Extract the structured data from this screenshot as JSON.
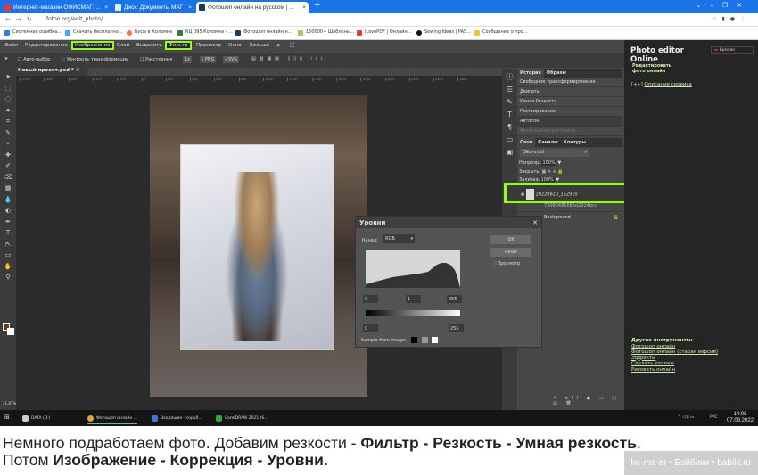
{
  "browser": {
    "tabs": [
      {
        "label": "Интернет-магазин ОФИСМАГ: ...",
        "color": "#e53935"
      },
      {
        "label": "Диск: Документы МАГ",
        "color": "#ffffff"
      },
      {
        "label": "Фотошоп онлайн на русском | ...",
        "color": "#1e3a5f",
        "active": true
      }
    ],
    "url": "fotoo.org/edit_photo/",
    "bookmarks": [
      "Системная ошибка...",
      "Скачать бесплатно...",
      "Бусы в Коломне",
      "КЦ 095 Коломна - ...",
      "Фотошоп онлайн н...",
      "150000+ Шаблоны...",
      "iLovePDF | Онлайн...",
      "Sewing Ideas | PAS...",
      "Сообщение о про..."
    ]
  },
  "editor": {
    "menu": [
      "Файл",
      "Редактирование",
      "Изображение",
      "Слой",
      "Выделить",
      "Фильтр",
      "Просмотр",
      "Окно",
      "Больше"
    ],
    "highlighted_menu": [
      "Изображение",
      "Фильтр"
    ],
    "options": {
      "auto_select": "Авто-выбор",
      "transform": "Контроль трансформации",
      "distances": "Расстояния",
      "scale": "1x",
      "png": "PNG",
      "svg": "SVG"
    },
    "doc_tab": "Новый проект.psd *",
    "ruler_ticks": [
      "-1000",
      "-800",
      "-600",
      "-400",
      "-200",
      "0",
      "200",
      "400",
      "600",
      "800",
      "1000",
      "1200",
      "1400",
      "1600",
      "1800",
      "2000",
      "2200",
      "2400",
      "2600"
    ],
    "zoom": "31.81%",
    "panel": {
      "tabs": [
        "История",
        "Образы"
      ],
      "history": [
        "Свободное трансформирование",
        "Двигать",
        "Умная Резкость",
        "Растрирование",
        "Автотон",
        "Яркость/Контрастность"
      ],
      "layer_tabs": [
        "Слои",
        "Каналы",
        "Контуры"
      ],
      "blend": "Обычный",
      "opacity_label": "Непрозр.:",
      "opacity": "100%",
      "lock_label": "Закрыть:",
      "fill_label": "Заливка:",
      "fill": "100%",
      "layers": [
        "20220820_152910",
        "73080485886d2024bcc",
        "Background"
      ]
    },
    "levels": {
      "title": "Уровни",
      "channel_label": "Канал:",
      "channel": "RGB",
      "ok": "OK",
      "reset": "Reset",
      "preview": "Просмотр",
      "input": [
        "0",
        "1",
        "255"
      ],
      "output": [
        "0",
        "255"
      ],
      "sample": "Sample from image:"
    }
  },
  "sidebar": {
    "title": "Photo editor Online",
    "subtitle": "Редактировать фото онлайн",
    "language": "Russian",
    "toggle": "[+/-]",
    "description_link": "Описание сервиса",
    "other_tools_title": "Другие инструменты:",
    "links": [
      "Фотошоп онлайн",
      "Фотошоп онлайн (старая версия)",
      "Эффекты",
      "Сделать коллаж",
      "Рисовать онлайн"
    ]
  },
  "taskbar": {
    "items": [
      "DATA (D:)",
      "Фотошоп онлайн ...",
      "Входящие - copy0...",
      "CorelDRAW 2021 (6..."
    ],
    "lang": "РУС",
    "time": "14:08",
    "date": "07.09.2022"
  },
  "caption": {
    "line1_a": "Немного подработаем фото. Добавим резкости - ",
    "line1_b": "Фильтр - Резкость - Умная резкость",
    "line1_c": ".",
    "line2_a": "Потом ",
    "line2_b": "Изображение - Коррекция - Уровни."
  },
  "watermark": "ko-ma-ar • Бэйбики • babiki.ru",
  "accent": "#8fff14"
}
